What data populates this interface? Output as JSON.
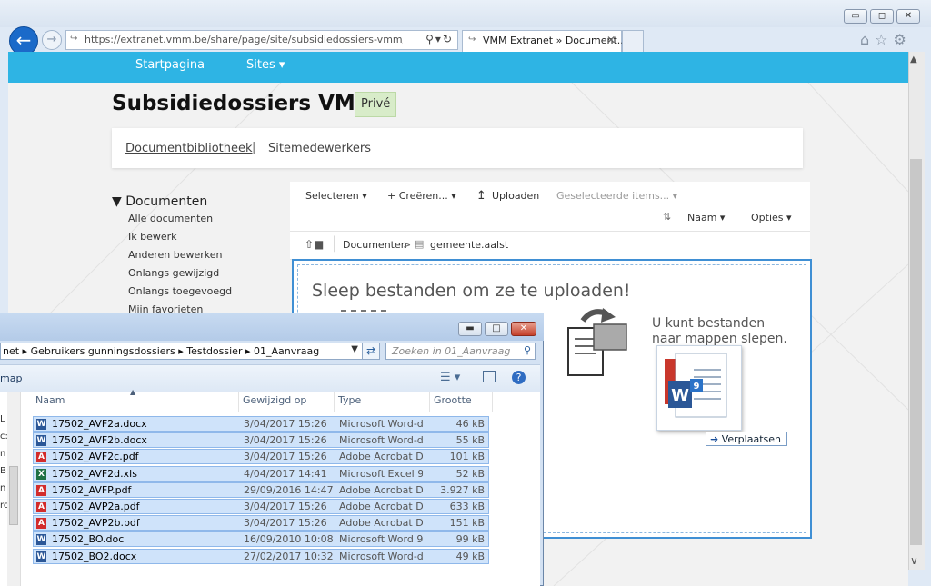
{
  "browser": {
    "url": "https://extranet.vmm.be/share/page/site/subsidiedossiers-vmm/documentlibr",
    "tab_title": "VMM Extranet » Document...",
    "tab_close": "✕",
    "window_buttons": [
      "▭",
      "◻",
      "✕"
    ]
  },
  "site": {
    "nav": [
      "Startpagina",
      "Sites ▾"
    ],
    "title": "Subsidiedossiers VMM",
    "badge": "Privé",
    "subnav": {
      "doclib": "Documentbibliotheek",
      "separator": "|",
      "members": "Sitemedewerkers"
    }
  },
  "sidebar": {
    "heading": "▼ Documenten",
    "items": [
      "Alle documenten",
      "Ik bewerk",
      "Anderen bewerken",
      "Onlangs gewijzigd",
      "Onlangs toegevoegd",
      "Mijn favorieten"
    ]
  },
  "toolbar": {
    "select": "Selecteren ▾",
    "create": "+ Creëren... ▾",
    "upload": "Uploaden",
    "selected_items": "Geselecteerde items... ▾",
    "sort": "Naam ▾",
    "options": "Opties ▾"
  },
  "breadcrumb": {
    "root": "Documenten",
    "separator": ">",
    "folder": "gemeente.aalst"
  },
  "dropzone": {
    "heading": "Sleep bestanden om ze te uploaden!",
    "hint": "U kunt bestanden naar mappen slepen.",
    "drag_badge": "9",
    "move_label": "Verplaatsen"
  },
  "explorer": {
    "path": "net ▸ Gebruikers gunningsdossiers ▸ Testdossier ▸ 01_Aanvraag",
    "search_placeholder": "Zoeken in 01_Aanvraag",
    "cmd_left": "map",
    "columns": [
      "Naam",
      "Gewijzigd op",
      "Type",
      "Grootte"
    ],
    "files": [
      {
        "name": "17502_AVF2a.docx",
        "date": "3/04/2017 15:26",
        "type": "Microsoft Word-d...",
        "size": "46 kB",
        "icon": "word-icon"
      },
      {
        "name": "17502_AVF2b.docx",
        "date": "3/04/2017 15:26",
        "type": "Microsoft Word-d...",
        "size": "55 kB",
        "icon": "word-icon"
      },
      {
        "name": "17502_AVF2c.pdf",
        "date": "3/04/2017 15:26",
        "type": "Adobe Acrobat D...",
        "size": "101 kB",
        "icon": "pdf-icon"
      },
      {
        "name": "17502_AVF2d.xls",
        "date": "4/04/2017 14:41",
        "type": "Microsoft Excel 97...",
        "size": "52 kB",
        "icon": "excel-icon"
      },
      {
        "name": "17502_AVFP.pdf",
        "date": "29/09/2016 14:47",
        "type": "Adobe Acrobat D...",
        "size": "3.927 kB",
        "icon": "pdf-icon"
      },
      {
        "name": "17502_AVP2a.pdf",
        "date": "3/04/2017 15:26",
        "type": "Adobe Acrobat D...",
        "size": "633 kB",
        "icon": "pdf-icon"
      },
      {
        "name": "17502_AVP2b.pdf",
        "date": "3/04/2017 15:26",
        "type": "Adobe Acrobat D...",
        "size": "151 kB",
        "icon": "pdf-icon"
      },
      {
        "name": "17502_BO.doc",
        "date": "16/09/2010 10:08",
        "type": "Microsoft Word 9...",
        "size": "99 kB",
        "icon": "word-icon"
      },
      {
        "name": "17502_BO2.docx",
        "date": "27/02/2017 10:32",
        "type": "Microsoft Word-d...",
        "size": "49 kB",
        "icon": "word-icon"
      }
    ],
    "left_fragments": [
      "L",
      "c:\\",
      "n",
      "B",
      "n",
      "rc"
    ]
  },
  "colors": {
    "nav_bar": "#2eb4e4",
    "selected_row": "#cfe3fa",
    "drop_border": "#3f8fd4",
    "badge": "#d8ecc9"
  }
}
